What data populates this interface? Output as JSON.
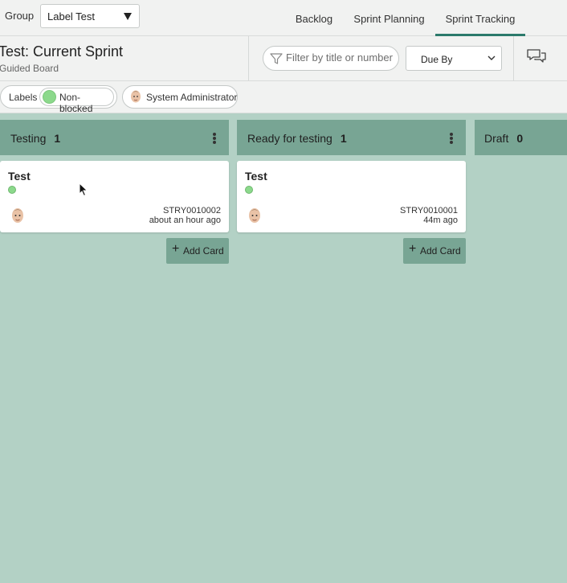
{
  "topbar": {
    "group_label": "Group",
    "group_value": "Label Test",
    "tabs": [
      {
        "label": "Backlog"
      },
      {
        "label": "Sprint Planning"
      },
      {
        "label": "Sprint Tracking",
        "active": true
      }
    ]
  },
  "header": {
    "title": "Test: Current Sprint",
    "subtitle": "Guided Board",
    "filter_placeholder": "Filter by title or number",
    "sort_value": "Due By"
  },
  "chips": {
    "labels_label": "Labels",
    "label_value": "Non-blocked",
    "user_name": "System Administrator"
  },
  "columns": [
    {
      "title": "Testing",
      "count": "1",
      "cards": [
        {
          "title": "Test",
          "number": "STRY0010002",
          "time": "about an hour ago"
        }
      ],
      "add_label": "Add Card"
    },
    {
      "title": "Ready for testing",
      "count": "1",
      "cards": [
        {
          "title": "Test",
          "number": "STRY0010001",
          "time": "44m ago"
        }
      ],
      "add_label": "Add Card"
    },
    {
      "title": "Draft",
      "count": "0",
      "cards": []
    }
  ],
  "colors": {
    "board_bg": "#b3d1c5",
    "column_header": "#78a594",
    "active_tab": "#2c7a6b",
    "label_dot": "#8cd98c"
  }
}
